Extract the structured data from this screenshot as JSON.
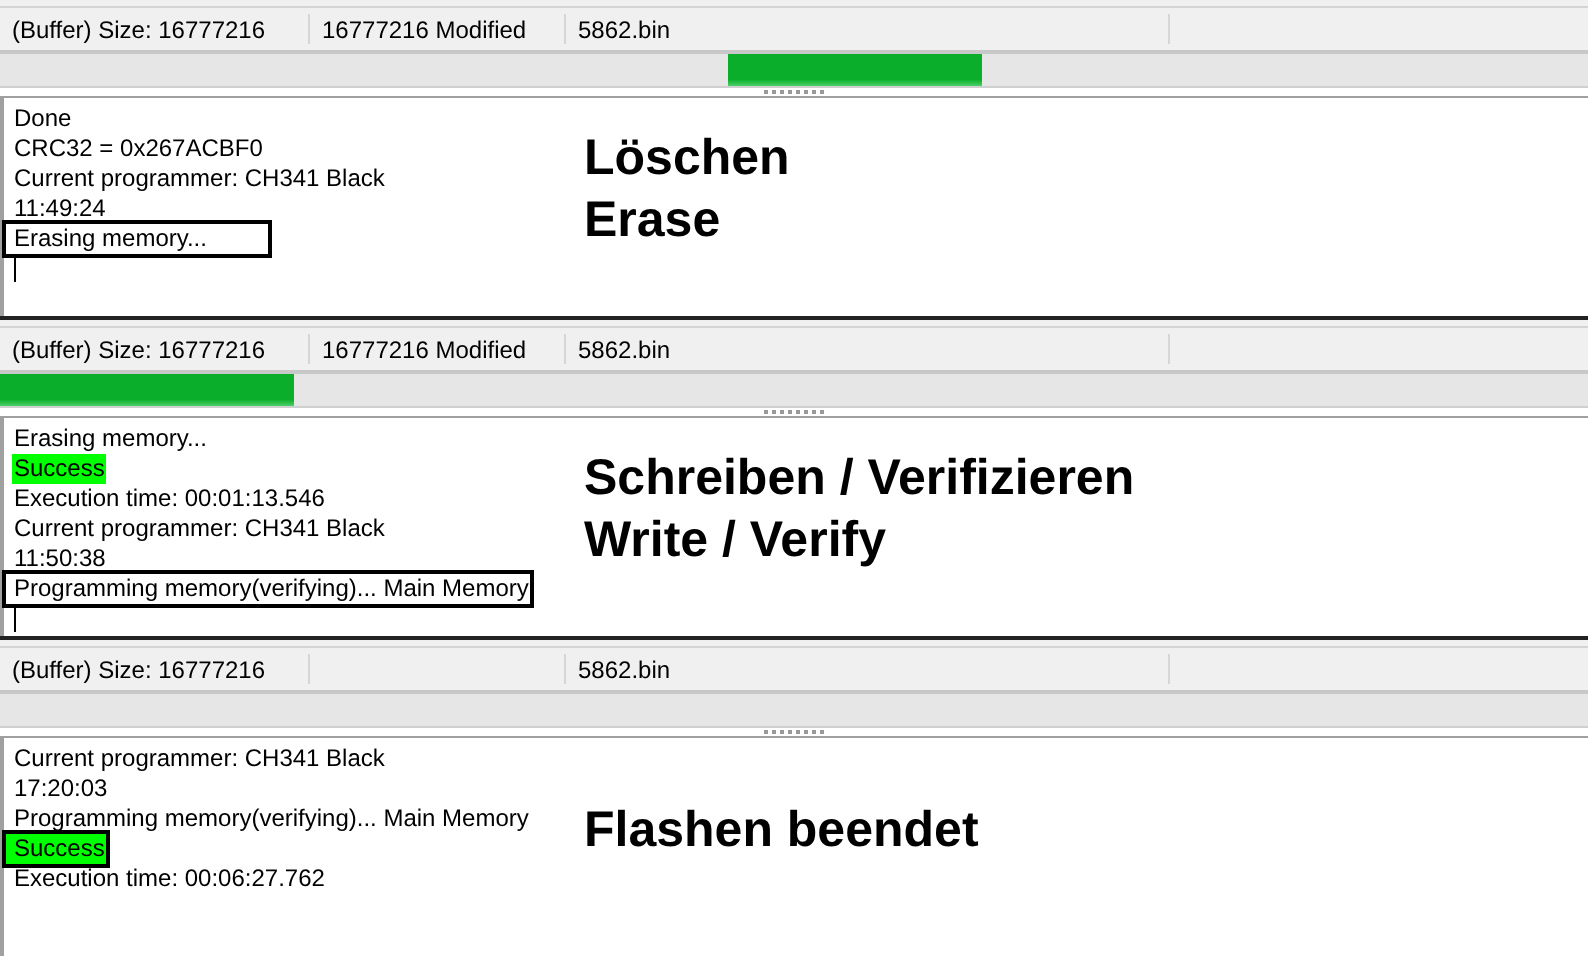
{
  "panels": [
    {
      "status": {
        "size": "(Buffer) Size: 16777216",
        "modified": "16777216 Modified",
        "file": "5862.bin"
      },
      "progress": {
        "kind": "marquee"
      },
      "log": [
        {
          "text": "Done",
          "highlight": false,
          "boxed": false
        },
        {
          "text": "CRC32 = 0x267ACBF0",
          "highlight": false,
          "boxed": false
        },
        {
          "text": "Current programmer: CH341 Black",
          "highlight": false,
          "boxed": false
        },
        {
          "text": "11:49:24",
          "highlight": false,
          "boxed": false
        },
        {
          "text": "Erasing memory...",
          "highlight": false,
          "boxed": true
        }
      ],
      "cursor": true,
      "caption": [
        "Löschen",
        "Erase"
      ]
    },
    {
      "status": {
        "size": "(Buffer) Size: 16777216",
        "modified": "16777216 Modified",
        "file": "5862.bin"
      },
      "progress": {
        "kind": "bar",
        "level": 0.185
      },
      "log": [
        {
          "text": "Erasing memory...",
          "highlight": false,
          "boxed": false
        },
        {
          "text": "Success",
          "highlight": true,
          "boxed": false
        },
        {
          "text": "Execution time: 00:01:13.546",
          "highlight": false,
          "boxed": false
        },
        {
          "text": "Current programmer: CH341 Black",
          "highlight": false,
          "boxed": false
        },
        {
          "text": "11:50:38",
          "highlight": false,
          "boxed": false
        },
        {
          "text": "Programming memory(verifying)... Main Memory",
          "highlight": false,
          "boxed": true
        }
      ],
      "cursor": true,
      "caption": [
        "Schreiben / Verifizieren",
        "Write / Verify"
      ]
    },
    {
      "status": {
        "size": "(Buffer) Size: 16777216",
        "file": "5862.bin"
      },
      "progress": {
        "kind": "bar",
        "level": 0
      },
      "log": [
        {
          "text": "Current programmer: CH341 Black",
          "highlight": false,
          "boxed": false
        },
        {
          "text": "17:20:03",
          "highlight": false,
          "boxed": false
        },
        {
          "text": "Programming memory(verifying)... Main Memory",
          "highlight": false,
          "boxed": false
        },
        {
          "text": "Success",
          "highlight": true,
          "boxed": true
        },
        {
          "text": "Execution time: 00:06:27.762",
          "highlight": false,
          "boxed": false
        }
      ],
      "cursor": false,
      "caption": [
        "Flashen beendet"
      ]
    }
  ]
}
